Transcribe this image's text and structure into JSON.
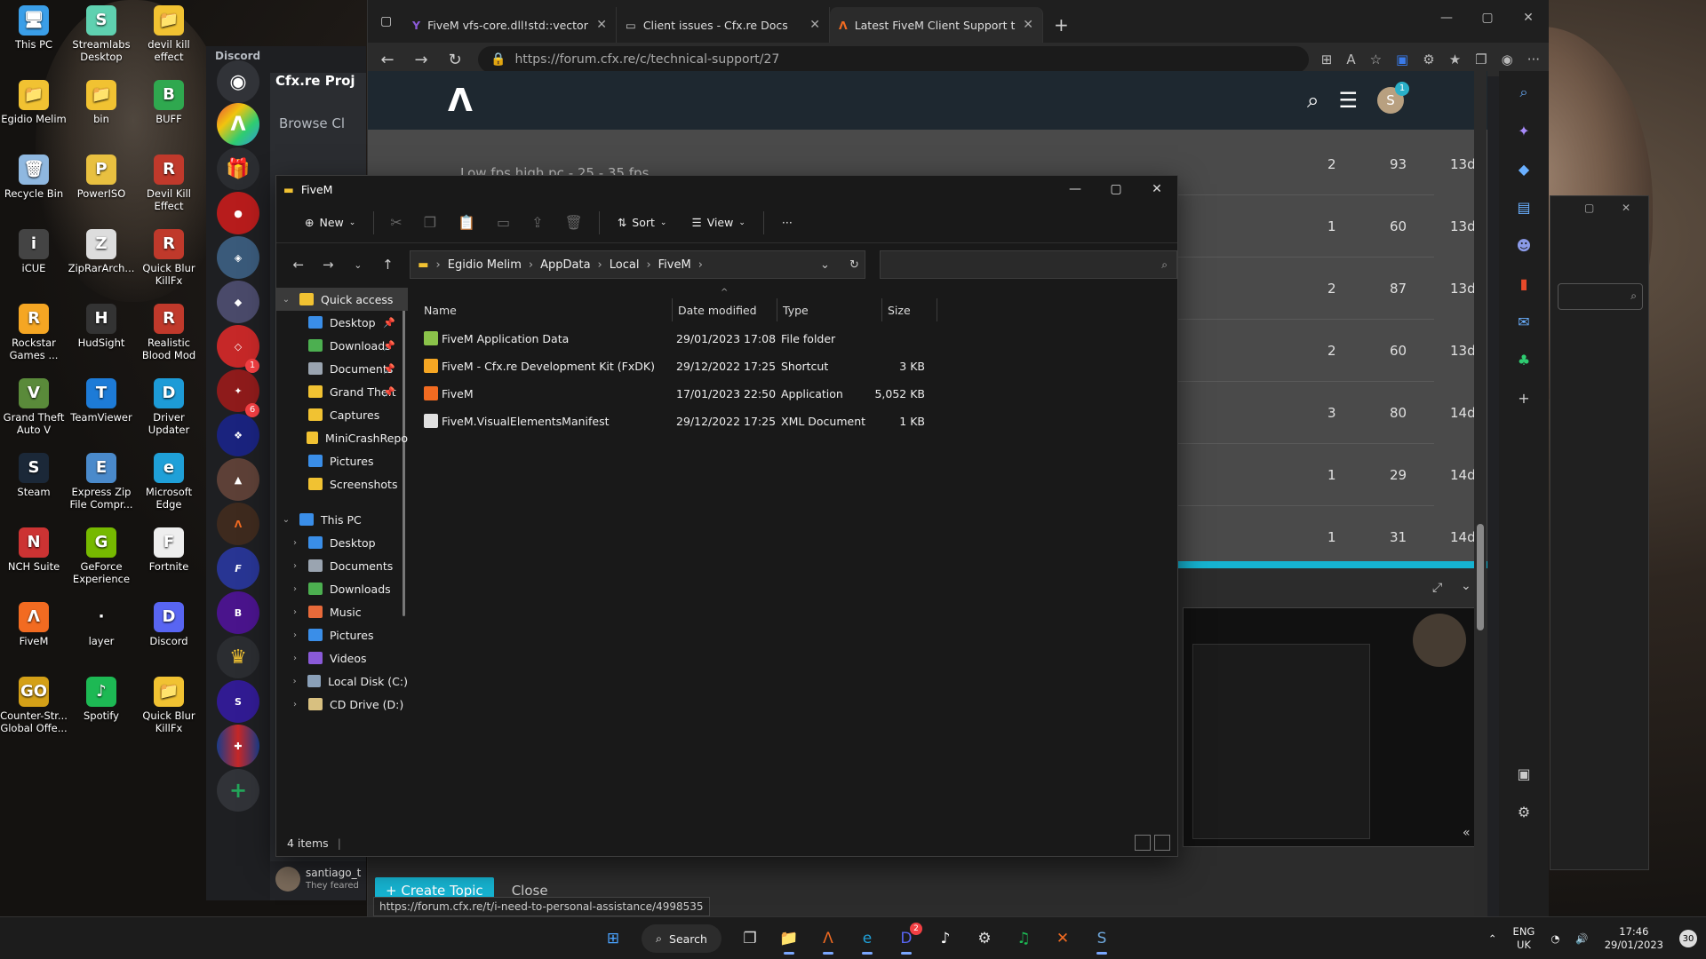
{
  "desktop": {
    "icons": [
      {
        "label": "This PC",
        "color": "#3a9ee8",
        "glyph": "🖥"
      },
      {
        "label": "Streamlabs Desktop",
        "color": "#5fd1b0",
        "glyph": "S"
      },
      {
        "label": "devil kill effect",
        "color": "#f1c232",
        "glyph": "📁"
      },
      {
        "label": "Egidio Melim",
        "color": "#f1c232",
        "glyph": "📁"
      },
      {
        "label": "bin",
        "color": "#f1c232",
        "glyph": "📁"
      },
      {
        "label": "BUFF",
        "color": "#2fa84f",
        "glyph": "B"
      },
      {
        "label": "Recycle Bin",
        "color": "#8fb8e0",
        "glyph": "🗑"
      },
      {
        "label": "PowerISO",
        "color": "#e8c040",
        "glyph": "P"
      },
      {
        "label": "Devil Kill Effect",
        "color": "#c0392b",
        "glyph": "R"
      },
      {
        "label": "iCUE",
        "color": "#444444",
        "glyph": "i"
      },
      {
        "label": "ZipRarArch...",
        "color": "#dddddd",
        "glyph": "Z"
      },
      {
        "label": "Quick Blur KillFx",
        "color": "#c0392b",
        "glyph": "R"
      },
      {
        "label": "Rockstar Games ...",
        "color": "#f5a623",
        "glyph": "R"
      },
      {
        "label": "HudSight",
        "color": "#333333",
        "glyph": "H"
      },
      {
        "label": "Realistic Blood Mod",
        "color": "#c0392b",
        "glyph": "R"
      },
      {
        "label": "Grand Theft Auto V",
        "color": "#5a8a3a",
        "glyph": "V"
      },
      {
        "label": "TeamViewer",
        "color": "#1d7bd7",
        "glyph": "T"
      },
      {
        "label": "Driver Updater",
        "color": "#1d9bd7",
        "glyph": "D"
      },
      {
        "label": "Steam",
        "color": "#1b2838",
        "glyph": "S"
      },
      {
        "label": "Express Zip File Compr...",
        "color": "#4a8acb",
        "glyph": "E"
      },
      {
        "label": "Microsoft Edge",
        "color": "#1fa0d8",
        "glyph": "e"
      },
      {
        "label": "NCH Suite",
        "color": "#cc3333",
        "glyph": "N"
      },
      {
        "label": "GeForce Experience",
        "color": "#76b900",
        "glyph": "G"
      },
      {
        "label": "Fortnite",
        "color": "#eeeeee",
        "glyph": "F"
      },
      {
        "label": "FiveM",
        "color": "#f26b21",
        "glyph": "Λ"
      },
      {
        "label": "layer",
        "color": "transparent",
        "glyph": "·"
      },
      {
        "label": "Discord",
        "color": "#5865f2",
        "glyph": "D"
      },
      {
        "label": "Counter-Str... Global Offe...",
        "color": "#d4a017",
        "glyph": "GO"
      },
      {
        "label": "Spotify",
        "color": "#1db954",
        "glyph": "♪"
      },
      {
        "label": "Quick Blur KillFx",
        "color": "#f1c232",
        "glyph": "📁"
      }
    ]
  },
  "discord": {
    "app_label": "Discord",
    "server_title": "Cfx.re Proj",
    "browse_label": "Browse Cl",
    "user_name": "santiago_t",
    "user_status": "They feared",
    "badges": [
      "1",
      "6"
    ]
  },
  "browser": {
    "tabs": [
      {
        "label": "FiveM vfs-core.dll!std::vector - Ye",
        "active": false
      },
      {
        "label": "Client issues - Cfx.re Docs",
        "active": false
      },
      {
        "label": "Latest FiveM Client Support topi",
        "active": true
      }
    ],
    "url": "https://forum.cfx.re/c/technical-support/27",
    "status_url": "https://forum.cfx.re/t/i-need-to-personal-assistance/4998535",
    "forum": {
      "avatar_letter": "S",
      "notif_count": "1",
      "partial_title": "Low fps high pc - 25 - 35 fps",
      "rows": [
        {
          "replies": "2",
          "views": "93",
          "activity": "13d"
        },
        {
          "replies": "1",
          "views": "60",
          "activity": "13d"
        },
        {
          "replies": "2",
          "views": "87",
          "activity": "13d"
        },
        {
          "replies": "2",
          "views": "60",
          "activity": "13d"
        },
        {
          "replies": "3",
          "views": "80",
          "activity": "14d"
        },
        {
          "replies": "1",
          "views": "29",
          "activity": "14d"
        },
        {
          "replies": "1",
          "views": "31",
          "activity": "14d"
        }
      ],
      "create_topic_label": "Create Topic",
      "close_label": "Close"
    }
  },
  "explorer": {
    "title": "FiveM",
    "toolbar": {
      "new_label": "New",
      "sort_label": "Sort",
      "view_label": "View",
      "more_label": "···"
    },
    "path": [
      "Egidio Melim",
      "AppData",
      "Local",
      "FiveM"
    ],
    "tree": [
      {
        "label": "Quick access",
        "level": 0,
        "chev": "⌄",
        "color": "#f1c232",
        "pin": false,
        "selected": true
      },
      {
        "label": "Desktop",
        "level": 1,
        "chev": "",
        "color": "#3a8ee8",
        "pin": true
      },
      {
        "label": "Downloads",
        "level": 1,
        "chev": "",
        "color": "#4caf50",
        "pin": true
      },
      {
        "label": "Documents",
        "level": 1,
        "chev": "",
        "color": "#9aa4b0",
        "pin": true
      },
      {
        "label": "Grand Theft",
        "level": 1,
        "chev": "",
        "color": "#f1c232",
        "pin": true
      },
      {
        "label": "Captures",
        "level": 1,
        "chev": "",
        "color": "#f1c232",
        "pin": false
      },
      {
        "label": "MiniCrashRepo",
        "level": 1,
        "chev": "",
        "color": "#f1c232",
        "pin": false
      },
      {
        "label": "Pictures",
        "level": 1,
        "chev": "",
        "color": "#3a8ee8",
        "pin": false
      },
      {
        "label": "Screenshots",
        "level": 1,
        "chev": "",
        "color": "#f1c232",
        "pin": false
      },
      {
        "label": "This PC",
        "level": 0,
        "chev": "⌄",
        "color": "#3a8ee8",
        "pin": false
      },
      {
        "label": "Desktop",
        "level": 1,
        "chev": "›",
        "color": "#3a8ee8",
        "pin": false
      },
      {
        "label": "Documents",
        "level": 1,
        "chev": "›",
        "color": "#9aa4b0",
        "pin": false
      },
      {
        "label": "Downloads",
        "level": 1,
        "chev": "›",
        "color": "#4caf50",
        "pin": false
      },
      {
        "label": "Music",
        "level": 1,
        "chev": "›",
        "color": "#e86a3a",
        "pin": false
      },
      {
        "label": "Pictures",
        "level": 1,
        "chev": "›",
        "color": "#3a8ee8",
        "pin": false
      },
      {
        "label": "Videos",
        "level": 1,
        "chev": "›",
        "color": "#8a5ad8",
        "pin": false
      },
      {
        "label": "Local Disk (C:)",
        "level": 1,
        "chev": "›",
        "color": "#8aa0b8",
        "pin": false
      },
      {
        "label": "CD Drive (D:)",
        "level": 1,
        "chev": "›",
        "color": "#d8c080",
        "pin": false
      }
    ],
    "columns": [
      "Name",
      "Date modified",
      "Type",
      "Size"
    ],
    "files": [
      {
        "name": "FiveM Application Data",
        "date": "29/01/2023 17:08",
        "type": "File folder",
        "size": "",
        "color": "#8bc34a"
      },
      {
        "name": "FiveM - Cfx.re Development Kit (FxDK)",
        "date": "29/12/2022 17:25",
        "type": "Shortcut",
        "size": "3 KB",
        "color": "#f5a623"
      },
      {
        "name": "FiveM",
        "date": "17/01/2023 22:50",
        "type": "Application",
        "size": "5,052 KB",
        "color": "#f26b21"
      },
      {
        "name": "FiveM.VisualElementsManifest",
        "date": "29/12/2022 17:25",
        "type": "XML Document",
        "size": "1 KB",
        "color": "#e0e0e0"
      }
    ],
    "status_text": "4 items"
  },
  "taskbar": {
    "search_label": "Search",
    "apps": [
      {
        "name": "start",
        "glyph": "⊞",
        "color": "#4aa3ff"
      },
      {
        "name": "search",
        "glyph": "",
        "color": ""
      },
      {
        "name": "task-view",
        "glyph": "❐",
        "color": "#ddd"
      },
      {
        "name": "file-explorer",
        "glyph": "📁",
        "color": "#f1c232"
      },
      {
        "name": "fivem",
        "glyph": "Λ",
        "color": "#f26b21"
      },
      {
        "name": "edge",
        "glyph": "e",
        "color": "#1fa0d8"
      },
      {
        "name": "discord",
        "glyph": "D",
        "color": "#5865f2"
      },
      {
        "name": "tiktok",
        "glyph": "♪",
        "color": "#fff"
      },
      {
        "name": "settings-app",
        "glyph": "⚙",
        "color": "#ddd"
      },
      {
        "name": "spotify",
        "glyph": "♫",
        "color": "#1db954"
      },
      {
        "name": "xbox",
        "glyph": "✕",
        "color": "#f26b21"
      },
      {
        "name": "steam",
        "glyph": "S",
        "color": "#6fa8dc"
      }
    ],
    "discord_badge": "2",
    "lang_top": "ENG",
    "lang_bottom": "UK",
    "time": "17:46",
    "date": "29/01/2023",
    "notif_count": "30"
  }
}
